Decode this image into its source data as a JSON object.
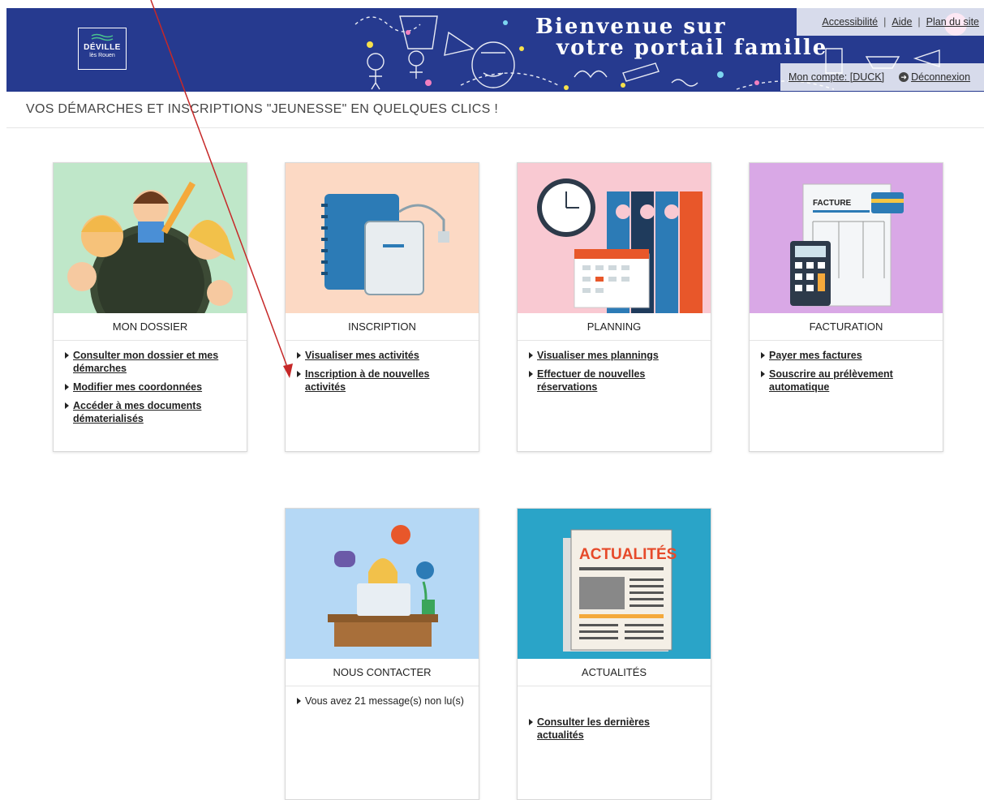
{
  "header": {
    "logo_line1": "DÉVILLE",
    "logo_line2": "lès Rouen",
    "banner_line1": "Bienvenue sur",
    "banner_line2": "votre portail famille",
    "toplinks": [
      "Accessibilité",
      "Aide",
      "Plan du site"
    ],
    "account_label": "Mon compte: [DUCK]",
    "logout_label": "Déconnexion"
  },
  "tagline": "VOS DÉMARCHES ET INSCRIPTIONS \"JEUNESSE\" EN QUELQUES CLICS !",
  "cards": [
    {
      "title": "MON DOSSIER",
      "links": [
        "Consulter mon dossier et mes démarches",
        "Modifier mes coordonnées",
        "Accéder à mes documents dématerialisés"
      ]
    },
    {
      "title": "INSCRIPTION",
      "links": [
        "Visualiser mes activités",
        "Inscription à de nouvelles activités"
      ]
    },
    {
      "title": "PLANNING",
      "links": [
        "Visualiser mes plannings",
        "Effectuer de nouvelles réservations"
      ]
    },
    {
      "title": "FACTURATION",
      "links": [
        "Payer mes factures",
        "Souscrire au prélèvement automatique"
      ]
    },
    {
      "title": "NOUS CONTACTER",
      "text": "Vous avez 21 message(s) non lu(s)"
    },
    {
      "title": "ACTUALITÉS",
      "links": [
        "Consulter les dernières actualités"
      ]
    }
  ],
  "illustrations": {
    "facture": "FACTURE",
    "actualites": "ACTUALITÉS"
  },
  "colors": {
    "header_bg": "#263a8f",
    "annotation_arrow": "#c62828"
  }
}
